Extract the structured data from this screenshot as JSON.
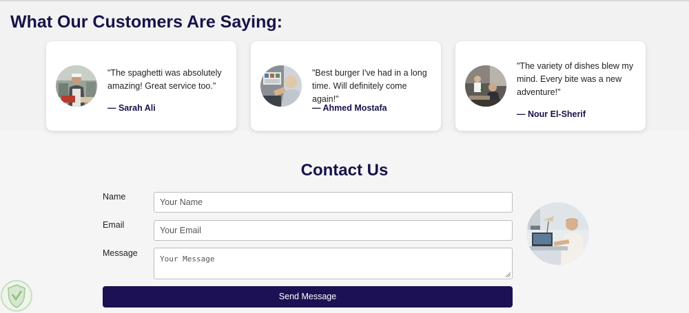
{
  "testimonials": {
    "title": "What Our Customers Are Saying:",
    "items": [
      {
        "quote": "\"The spaghetti was absolutely amazing! Great service too.\"",
        "author": "— Sarah Ali",
        "avatar_icon": "chef-photo"
      },
      {
        "quote": "\"Best burger I've had in a long time. Will definitely come again!\"",
        "author": "— Ahmed Mostafa",
        "avatar_icon": "customer-photo"
      },
      {
        "quote": "\"The variety of dishes blew my mind. Every bite was a new adventure!\"",
        "author": "— Nour El-Sherif",
        "avatar_icon": "diner-photo"
      }
    ]
  },
  "contact": {
    "title": "Contact Us",
    "name_label": "Name",
    "name_placeholder": "Your Name",
    "email_label": "Email",
    "email_placeholder": "Your Email",
    "message_label": "Message",
    "message_placeholder": "Your Message",
    "send_label": "Send Message",
    "photo_icon": "office-worker-photo"
  },
  "colors": {
    "brand_navy": "#16124a",
    "button_bg": "#1b1153",
    "page_bg": "#f5f5f5"
  }
}
